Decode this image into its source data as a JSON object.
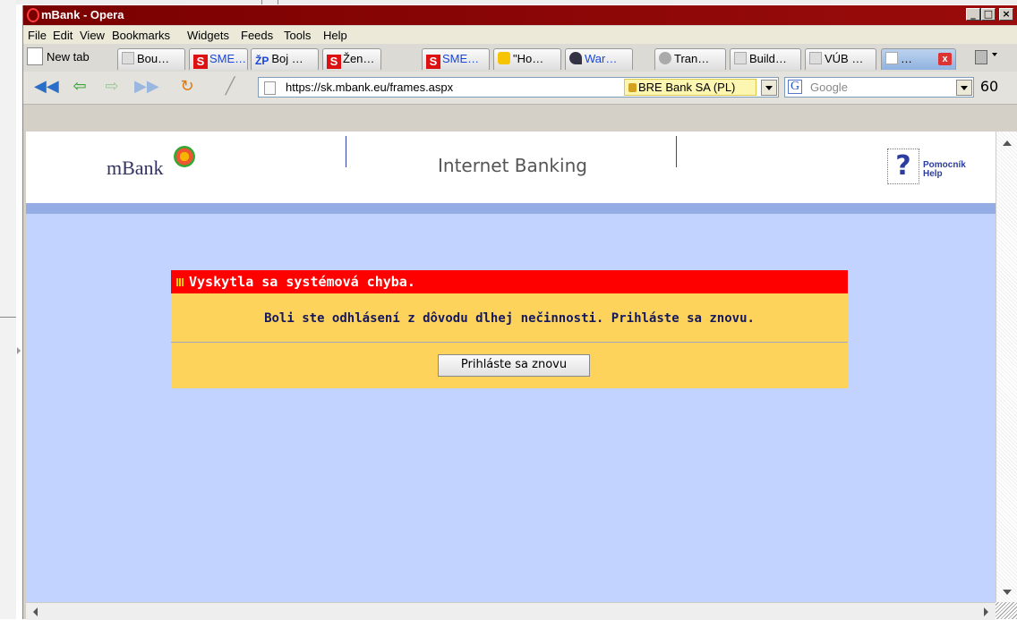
{
  "window": {
    "title": "mBank - Opera"
  },
  "menu": [
    "File",
    "Edit",
    "View",
    "Bookmarks",
    "Widgets",
    "Feeds",
    "Tools",
    "Help"
  ],
  "tabs": {
    "new_tab": "New tab",
    "items": [
      "Bou…",
      "SME…",
      "Boj …",
      "Žen…",
      "SME…",
      "\"Ho…",
      "War…",
      "Tran…",
      "Build…",
      "VÚB …",
      "…"
    ]
  },
  "address": {
    "url": "https://sk.mbank.eu/frames.aspx",
    "security": "BRE Bank SA (PL)"
  },
  "search": {
    "placeholder": "Google"
  },
  "header": {
    "logo": "mBank",
    "product": "Internet Banking",
    "help1": "Pomocník",
    "help2": "Help"
  },
  "error": {
    "title": "Vyskytla sa systémová chyba.",
    "message": "Boli ste odhlásení z dôvodu dlhej nečinnosti. Prihláste sa znovu.",
    "button": "Prihláste sa znovu"
  },
  "colors": {
    "content_bg": "#c3d3ff",
    "error_header": "#ff0000",
    "error_body": "#fed35c",
    "titlebar": "#8a0505"
  }
}
